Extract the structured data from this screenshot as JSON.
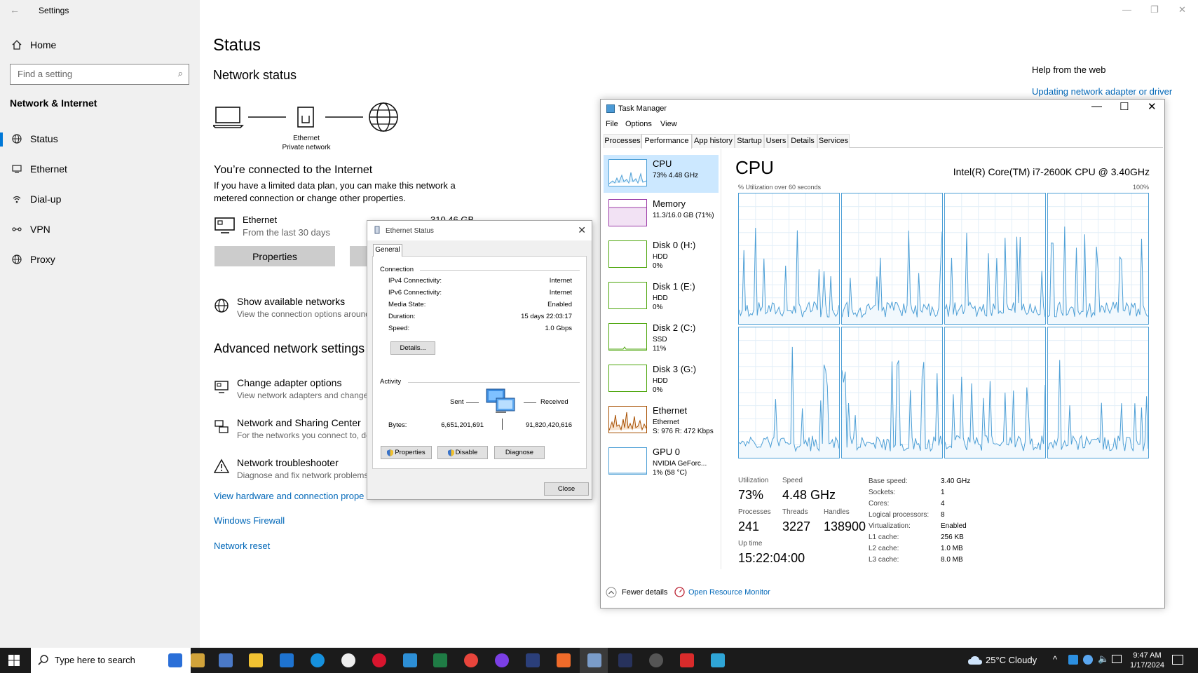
{
  "settings": {
    "window_title": "Settings",
    "home": "Home",
    "search_placeholder": "Find a setting",
    "section": "Network & Internet",
    "nav": [
      {
        "label": "Status",
        "icon": "globe-icon"
      },
      {
        "label": "Ethernet",
        "icon": "ethernet-icon"
      },
      {
        "label": "Dial-up",
        "icon": "dialup-icon"
      },
      {
        "label": "VPN",
        "icon": "vpn-icon"
      },
      {
        "label": "Proxy",
        "icon": "globe-icon"
      }
    ],
    "page_title": "Status",
    "network_status": "Network status",
    "diagram_label": "Ethernet",
    "diagram_sublabel": "Private network",
    "connected_heading": "You’re connected to the Internet",
    "connected_desc": "If you have a limited data plan, you can make this network a metered connection or change other properties.",
    "ethernet_name": "Ethernet",
    "ethernet_period": "From the last 30 days",
    "ethernet_amount": "310.46 GB",
    "properties_btn": "Properties",
    "show_networks_title": "Show available networks",
    "show_networks_sub": "View the connection options around",
    "advanced_heading": "Advanced network settings",
    "change_adapter_title": "Change adapter options",
    "change_adapter_sub": "View network adapters and change c",
    "sharing_center_title": "Network and Sharing Center",
    "sharing_center_sub": "For the networks you connect to, de",
    "troubleshooter_title": "Network troubleshooter",
    "troubleshooter_sub": "Diagnose and fix network problems.",
    "link_hardware": "View hardware and connection prope",
    "link_firewall": "Windows Firewall",
    "link_reset": "Network reset",
    "help_heading": "Help from the web",
    "help_link": "Updating network adapter or driver"
  },
  "ethernet_dialog": {
    "title": "Ethernet Status",
    "tab": "General",
    "connection_group": "Connection",
    "rows": [
      {
        "label": "IPv4 Connectivity:",
        "value": "Internet"
      },
      {
        "label": "IPv6 Connectivity:",
        "value": "Internet"
      },
      {
        "label": "Media State:",
        "value": "Enabled"
      },
      {
        "label": "Duration:",
        "value": "15 days 22:03:17"
      },
      {
        "label": "Speed:",
        "value": "1.0 Gbps"
      }
    ],
    "details_btn": "Details...",
    "activity_group": "Activity",
    "sent_label": "Sent",
    "received_label": "Received",
    "bytes_label": "Bytes:",
    "bytes_sent": "6,651,201,691",
    "bytes_received": "91,820,420,616",
    "properties_btn": "Properties",
    "disable_btn": "Disable",
    "diagnose_btn": "Diagnose",
    "close_btn": "Close"
  },
  "task_manager": {
    "title": "Task Manager",
    "menus": [
      "File",
      "Options",
      "View"
    ],
    "tabs": [
      "Processes",
      "Performance",
      "App history",
      "Startup",
      "Users",
      "Details",
      "Services"
    ],
    "resources": [
      {
        "name": "CPU",
        "sub1": "73% 4.48 GHz",
        "sub2": "",
        "sub3": ""
      },
      {
        "name": "Memory",
        "sub1": "11.3/16.0 GB (71%)",
        "sub2": "",
        "sub3": ""
      },
      {
        "name": "Disk 0 (H:)",
        "sub1": "HDD",
        "sub2": "0%",
        "sub3": ""
      },
      {
        "name": "Disk 1 (E:)",
        "sub1": "HDD",
        "sub2": "0%",
        "sub3": ""
      },
      {
        "name": "Disk 2 (C:)",
        "sub1": "SSD",
        "sub2": "11%",
        "sub3": ""
      },
      {
        "name": "Disk 3 (G:)",
        "sub1": "HDD",
        "sub2": "0%",
        "sub3": ""
      },
      {
        "name": "Ethernet",
        "sub1": "Ethernet",
        "sub2": "S: 976  R: 472 Kbps",
        "sub3": ""
      },
      {
        "name": "GPU 0",
        "sub1": "NVIDIA GeForc...",
        "sub2": "1% (58 °C)",
        "sub3": ""
      }
    ],
    "cpu_heading": "CPU",
    "cpu_model": "Intel(R) Core(TM) i7-2600K CPU @ 3.40GHz",
    "util_label": "% Utilization over 60 seconds",
    "util_max": "100%",
    "stats": {
      "utilization_label": "Utilization",
      "utilization": "73%",
      "speed_label": "Speed",
      "speed": "4.48 GHz",
      "processes_label": "Processes",
      "processes": "241",
      "threads_label": "Threads",
      "threads": "3227",
      "handles_label": "Handles",
      "handles": "138900",
      "uptime_label": "Up time",
      "uptime": "15:22:04:00"
    },
    "specs": [
      {
        "label": "Base speed:",
        "value": "3.40 GHz"
      },
      {
        "label": "Sockets:",
        "value": "1"
      },
      {
        "label": "Cores:",
        "value": "4"
      },
      {
        "label": "Logical processors:",
        "value": "8"
      },
      {
        "label": "Virtualization:",
        "value": "Enabled"
      },
      {
        "label": "L1 cache:",
        "value": "256 KB"
      },
      {
        "label": "L2 cache:",
        "value": "1.0 MB"
      },
      {
        "label": "L3 cache:",
        "value": "8.0 MB"
      }
    ],
    "fewer_details": "Fewer details",
    "open_resource_monitor": "Open Resource Monitor"
  },
  "taskbar": {
    "search_placeholder": "Type here to search",
    "weather": "25°C  Cloudy",
    "time": "9:47 AM",
    "date": "1/17/2024"
  },
  "colors": {
    "accent": "#0078d7",
    "link": "#0067b8",
    "cpu_graph": "#4d9fd6",
    "memory_graph": "#9c3ca8",
    "disk_graph": "#4da60c",
    "ethernet_graph": "#a74f01"
  }
}
